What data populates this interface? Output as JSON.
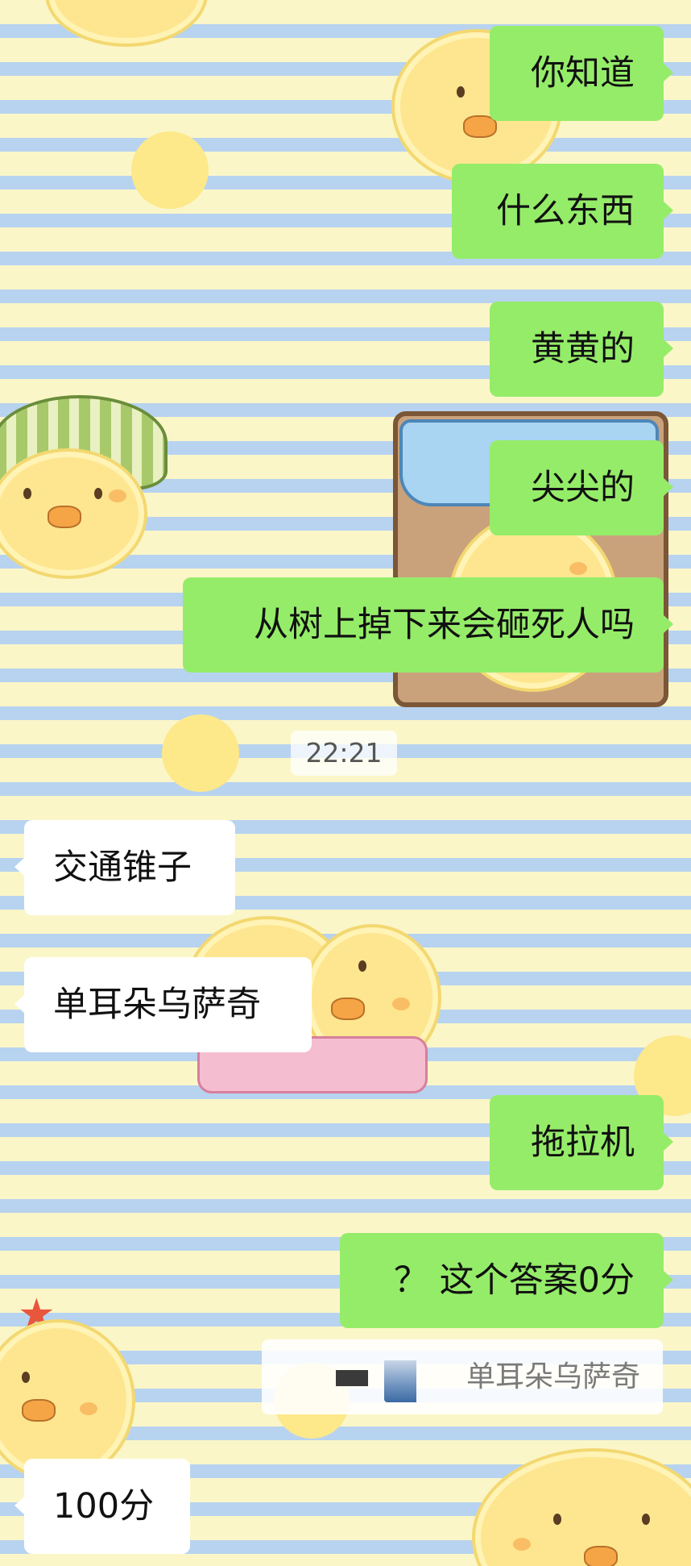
{
  "messages": [
    {
      "id": "m1",
      "text": "你知道",
      "side": "sent"
    },
    {
      "id": "m2",
      "text": "什么东西",
      "side": "sent"
    },
    {
      "id": "m3",
      "text": "黄黄的",
      "side": "sent"
    },
    {
      "id": "m4",
      "text": "尖尖的",
      "side": "sent"
    },
    {
      "id": "m5",
      "text": "从树上掉下来会砸死人吗",
      "side": "sent"
    },
    {
      "id": "m6",
      "text": "交通锥子",
      "side": "received"
    },
    {
      "id": "m7",
      "text": "单耳朵乌萨奇",
      "side": "received"
    },
    {
      "id": "m8",
      "text": "拖拉机",
      "side": "sent"
    },
    {
      "id": "m9",
      "text": "？ 这个答案0分",
      "side": "sent"
    },
    {
      "id": "m10",
      "text": "100分",
      "side": "received"
    }
  ],
  "timestamp": "22:21",
  "quote": {
    "text": "单耳朵乌萨奇"
  },
  "colors": {
    "sent_bubble": "#95ec69",
    "received_bubble": "#ffffff",
    "wallpaper_yellow": "#fbf6c8",
    "wallpaper_blue": "#b7d3f0"
  }
}
